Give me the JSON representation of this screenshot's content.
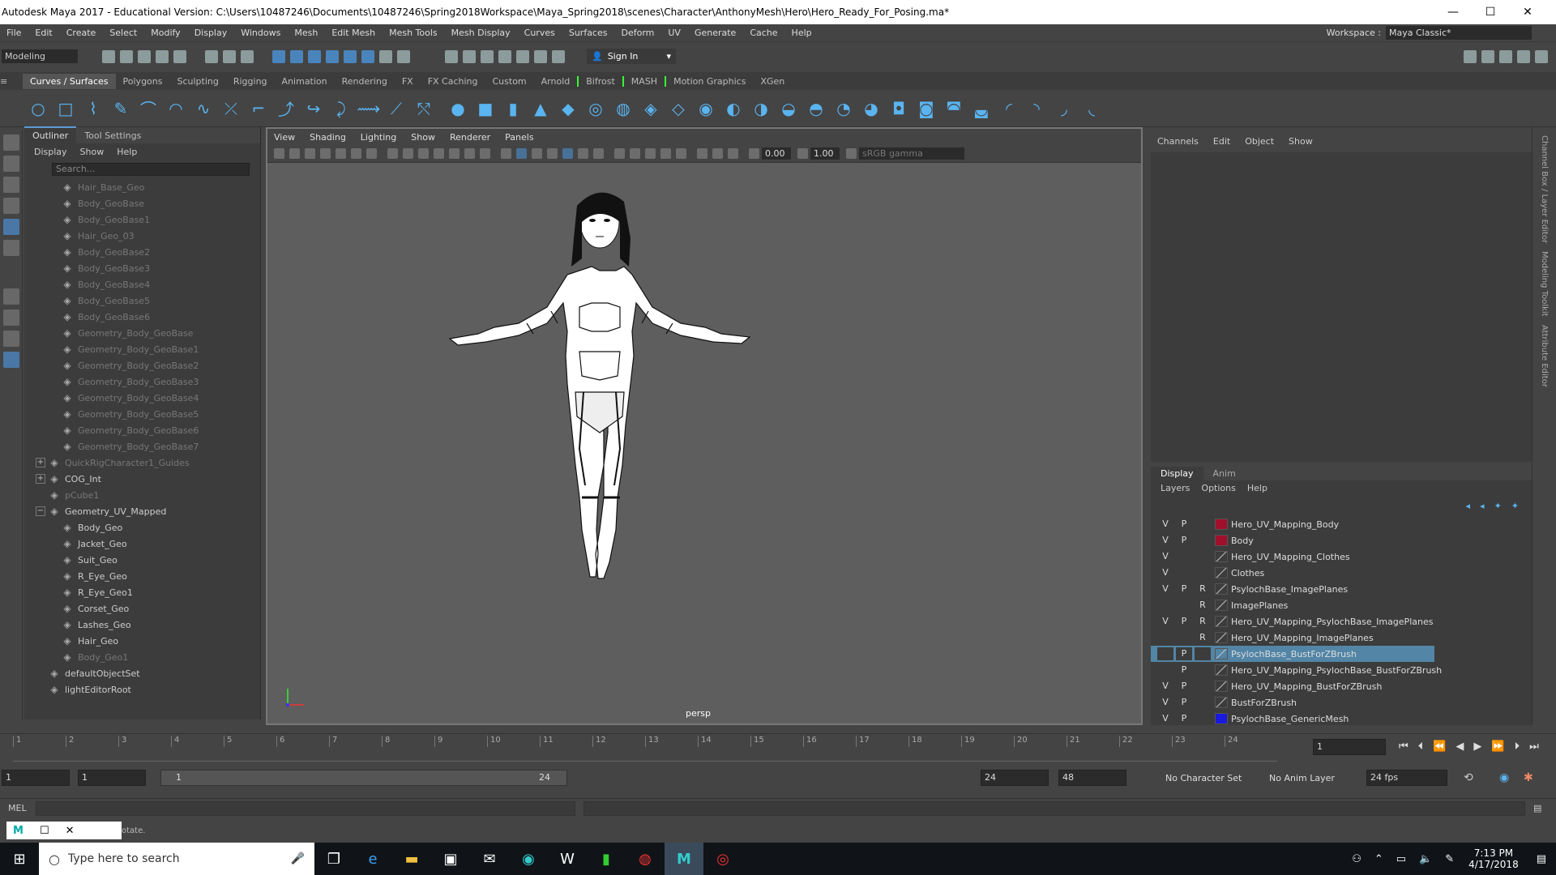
{
  "window": {
    "title": "Autodesk Maya 2017 - Educational Version: C:\\Users\\10487246\\Documents\\10487246\\Spring2018Workspace\\Maya_Spring2018\\scenes\\Character\\AnthonyMesh\\Hero\\Hero_Ready_For_Posing.ma*"
  },
  "menu": [
    "File",
    "Edit",
    "Create",
    "Select",
    "Modify",
    "Display",
    "Windows",
    "Mesh",
    "Edit Mesh",
    "Mesh Tools",
    "Mesh Display",
    "Curves",
    "Surfaces",
    "Deform",
    "UV",
    "Generate",
    "Cache",
    "Help"
  ],
  "workspace": {
    "label": "Workspace :",
    "value": "Maya Classic*"
  },
  "status": {
    "mode": "Modeling",
    "sign_in": "Sign In"
  },
  "shelf_tabs": [
    "Curves / Surfaces",
    "Polygons",
    "Sculpting",
    "Rigging",
    "Animation",
    "Rendering",
    "FX",
    "FX Caching",
    "Custom",
    "Arnold",
    "Bifrost",
    "MASH",
    "Motion Graphics",
    "XGen"
  ],
  "outliner": {
    "tabs": [
      "Outliner",
      "Tool Settings"
    ],
    "menu": [
      "Display",
      "Show",
      "Help"
    ],
    "search_placeholder": "Search...",
    "nodes": [
      {
        "label": "Hair_Base_Geo",
        "dim": true,
        "indent": 1
      },
      {
        "label": "Body_GeoBase",
        "dim": true,
        "indent": 1
      },
      {
        "label": "Body_GeoBase1",
        "dim": true,
        "indent": 1
      },
      {
        "label": "Hair_Geo_03",
        "dim": true,
        "indent": 1
      },
      {
        "label": "Body_GeoBase2",
        "dim": true,
        "indent": 1
      },
      {
        "label": "Body_GeoBase3",
        "dim": true,
        "indent": 1
      },
      {
        "label": "Body_GeoBase4",
        "dim": true,
        "indent": 1
      },
      {
        "label": "Body_GeoBase5",
        "dim": true,
        "indent": 1
      },
      {
        "label": "Body_GeoBase6",
        "dim": true,
        "indent": 1
      },
      {
        "label": "Geometry_Body_GeoBase",
        "dim": true,
        "indent": 1
      },
      {
        "label": "Geometry_Body_GeoBase1",
        "dim": true,
        "indent": 1
      },
      {
        "label": "Geometry_Body_GeoBase2",
        "dim": true,
        "indent": 1
      },
      {
        "label": "Geometry_Body_GeoBase3",
        "dim": true,
        "indent": 1
      },
      {
        "label": "Geometry_Body_GeoBase4",
        "dim": true,
        "indent": 1
      },
      {
        "label": "Geometry_Body_GeoBase5",
        "dim": true,
        "indent": 1
      },
      {
        "label": "Geometry_Body_GeoBase6",
        "dim": true,
        "indent": 1
      },
      {
        "label": "Geometry_Body_GeoBase7",
        "dim": true,
        "indent": 1
      },
      {
        "label": "QuickRigCharacter1_Guides",
        "dim": true,
        "indent": 0,
        "expander": "+"
      },
      {
        "label": "COG_Int",
        "dim": false,
        "indent": 0,
        "expander": "+"
      },
      {
        "label": "pCube1",
        "dim": true,
        "indent": 0
      },
      {
        "label": "Geometry_UV_Mapped",
        "dim": false,
        "indent": 0,
        "expander": "−"
      },
      {
        "label": "Body_Geo",
        "dim": false,
        "indent": 1
      },
      {
        "label": "Jacket_Geo",
        "dim": false,
        "indent": 1
      },
      {
        "label": "Suit_Geo",
        "dim": false,
        "indent": 1
      },
      {
        "label": "R_Eye_Geo",
        "dim": false,
        "indent": 1
      },
      {
        "label": "R_Eye_Geo1",
        "dim": false,
        "indent": 1
      },
      {
        "label": "Corset_Geo",
        "dim": false,
        "indent": 1
      },
      {
        "label": "Lashes_Geo",
        "dim": false,
        "indent": 1
      },
      {
        "label": "Hair_Geo",
        "dim": false,
        "indent": 1
      },
      {
        "label": "Body_Geo1",
        "dim": true,
        "indent": 1
      },
      {
        "label": "defaultObjectSet",
        "dim": false,
        "indent": 0
      },
      {
        "label": "lightEditorRoot",
        "dim": false,
        "indent": 0
      }
    ]
  },
  "viewport": {
    "menu": [
      "View",
      "Shading",
      "Lighting",
      "Show",
      "Renderer",
      "Panels"
    ],
    "near": "0.00",
    "far": "1.00",
    "color_space": "sRGB gamma",
    "camera": "persp"
  },
  "channel_box": {
    "menu": [
      "Channels",
      "Edit",
      "Object",
      "Show"
    ]
  },
  "layer_editor": {
    "tabs": [
      "Display",
      "Anim"
    ],
    "menu": [
      "Layers",
      "Options",
      "Help"
    ],
    "layers": [
      {
        "v": "V",
        "p": "P",
        "r": "",
        "color": "#a0102a",
        "name": "Hero_UV_Mapping_Body"
      },
      {
        "v": "V",
        "p": "P",
        "r": "",
        "color": "#a0102a",
        "name": "Body"
      },
      {
        "v": "V",
        "p": "",
        "r": "",
        "color": "",
        "name": "Hero_UV_Mapping_Clothes"
      },
      {
        "v": "V",
        "p": "",
        "r": "",
        "color": "",
        "name": "Clothes"
      },
      {
        "v": "V",
        "p": "P",
        "r": "R",
        "color": "",
        "name": "PsylochBase_ImagePlanes"
      },
      {
        "v": "",
        "p": "",
        "r": "R",
        "color": "",
        "name": "ImagePlanes"
      },
      {
        "v": "V",
        "p": "P",
        "r": "R",
        "color": "",
        "name": "Hero_UV_Mapping_PsylochBase_ImagePlanes"
      },
      {
        "v": "",
        "p": "",
        "r": "R",
        "color": "",
        "name": "Hero_UV_Mapping_ImagePlanes"
      },
      {
        "v": "",
        "p": "P",
        "r": "",
        "color": "",
        "name": "PsylochBase_BustForZBrush",
        "selected": true
      },
      {
        "v": "",
        "p": "P",
        "r": "",
        "color": "",
        "name": "Hero_UV_Mapping_PsylochBase_BustForZBrush"
      },
      {
        "v": "V",
        "p": "P",
        "r": "",
        "color": "",
        "name": "Hero_UV_Mapping_BustForZBrush"
      },
      {
        "v": "V",
        "p": "P",
        "r": "",
        "color": "",
        "name": "BustForZBrush"
      },
      {
        "v": "V",
        "p": "P",
        "r": "",
        "color": "#1a1adc",
        "name": "PsylochBase_GenericMesh"
      }
    ]
  },
  "right_strip": [
    "Channel Box / Layer Editor",
    "Modeling Toolkit",
    "Attribute Editor"
  ],
  "timeline": {
    "ticks": [
      "1",
      "2",
      "3",
      "4",
      "5",
      "6",
      "7",
      "8",
      "9",
      "10",
      "11",
      "12",
      "13",
      "14",
      "15",
      "16",
      "17",
      "18",
      "19",
      "20",
      "21",
      "22",
      "23",
      "24"
    ],
    "current_frame": "1"
  },
  "range": {
    "start": "1",
    "anim_start": "1",
    "range_start": "1",
    "range_end": "24",
    "anim_end": "24",
    "end": "48",
    "character_set": "No Character Set",
    "anim_layer": "No Anim Layer",
    "fps": "24 fps"
  },
  "command": {
    "lang": "MEL"
  },
  "helpline": {
    "text": "otate."
  },
  "taskbar": {
    "search_placeholder": "Type here to search",
    "time": "7:13 PM",
    "date": "4/17/2018"
  }
}
